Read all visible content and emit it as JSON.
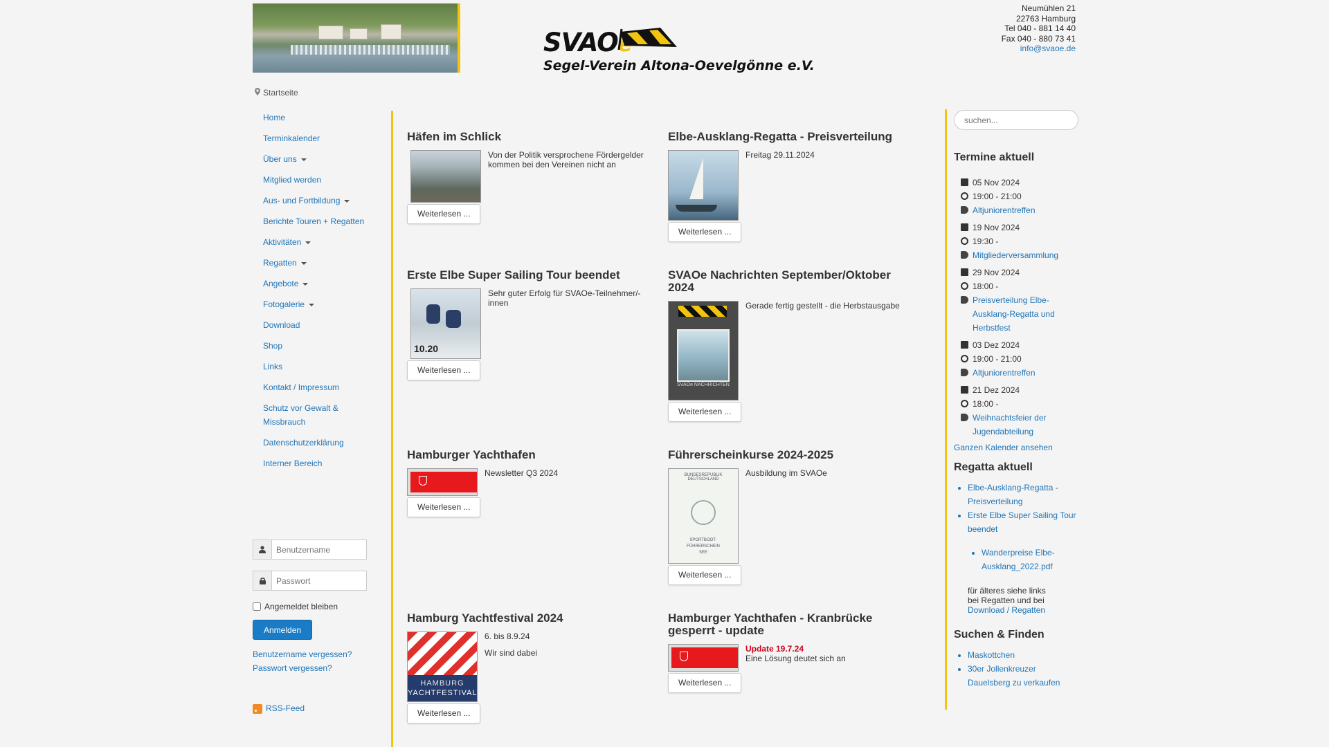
{
  "header": {
    "logo_text": "SVAO",
    "logo_e": "e",
    "logo_subtitle": "Segel-Verein Altona-Oevelgönne e.V.",
    "address_lines": [
      "Neumühlen 21",
      "22763 Hamburg",
      "Tel 040 - 881 14 40",
      "Fax 040 - 880 73 41"
    ],
    "email": "info@svaoe.de"
  },
  "breadcrumb": "Startseite",
  "nav": {
    "items": [
      {
        "label": "Home"
      },
      {
        "label": "Terminkalender"
      },
      {
        "label": "Über uns"
      },
      {
        "label": "Mitglied werden"
      },
      {
        "label": "Aus- und Fortbildung"
      },
      {
        "label": "Berichte Touren + Regatten"
      },
      {
        "label": "Aktivitäten"
      },
      {
        "label": "Regatten"
      },
      {
        "label": "Angebote"
      },
      {
        "label": "Fotogalerie"
      },
      {
        "label": "Download"
      },
      {
        "label": "Shop"
      },
      {
        "label": "Links"
      },
      {
        "label": "Kontakt / Impressum"
      },
      {
        "label": "Schutz vor Gewalt & Missbrauch"
      },
      {
        "label": "Datenschutzerklärung"
      },
      {
        "label": "Interner Bereich"
      }
    ]
  },
  "login": {
    "username_placeholder": "Benutzername",
    "password_placeholder": "Passwort",
    "remember_label": "Angemeldet bleiben",
    "submit_label": "Anmelden",
    "forgot_username": "Benutzername vergessen?",
    "forgot_password": "Passwort vergessen?",
    "rss_label": "RSS-Feed"
  },
  "articles": {
    "more_label": "Weiterlesen ...",
    "a1": {
      "title": "Häfen im Schlick",
      "intro": "Von der Politik versprochene Fördergelder kommen bei den Vereinen nicht an"
    },
    "a2": {
      "title": "Elbe-Ausklang-Regatta - Preisverteilung",
      "intro": "Freitag 29.11.2024"
    },
    "a3": {
      "title": "Erste Elbe Super Sailing Tour beendet",
      "intro": "Sehr guter Erfolg für SVAOe-Teilnehmer/-innen",
      "thumb_text": "10.20"
    },
    "a4": {
      "title": "SVAOe Nachrichten September/Oktober 2024",
      "intro": "Gerade fertig gestellt - die Herbstausgabe",
      "thumb_text": "SVAOe NACHRICHTEN"
    },
    "a5": {
      "title": "Hamburger Yachthafen",
      "intro": "Newsletter Q3 2024"
    },
    "a6": {
      "title": "Führerscheinkurse 2024-2025",
      "intro": "Ausbildung im SVAOe",
      "thumb_top": "BUNDESREPUBLIK DEUTSCHLAND",
      "thumb_line1": "SPORTBOOT-",
      "thumb_line2": "FÜHRERSCHEIN",
      "thumb_line3": "SEE"
    },
    "a7": {
      "title": "Hamburg Yachtfestival 2024",
      "intro": "6. bis 8.9.24",
      "intro2": "Wir sind dabei",
      "thumb_line1": "HAMBURG",
      "thumb_line2": "YACHTFESTIVAL"
    },
    "a8": {
      "title": "Hamburger Yachthafen - Kranbrücke gesperrt - update",
      "update": "Update 19.7.24",
      "intro": "Eine Lösung deutet sich an"
    }
  },
  "sidebar": {
    "search_placeholder": "suchen...",
    "termine_heading": "Termine aktuell",
    "events": [
      {
        "date": "05 Nov 2024",
        "time": "19:00 - 21:00",
        "title": "Altjuniorentreffen"
      },
      {
        "date": "19 Nov 2024",
        "time": "19:30 -",
        "title": "Mitgliederversammlung"
      },
      {
        "date": "29 Nov 2024",
        "time": "18:00 -",
        "title": "Preisverteilung Elbe-Ausklang-Regatta und Herbstfest"
      },
      {
        "date": "03 Dez 2024",
        "time": "19:00 - 21:00",
        "title": "Altjuniorentreffen"
      },
      {
        "date": "21 Dez 2024",
        "time": "18:00 -",
        "title": "Weihnachtsfeier der Jugendabteilung"
      }
    ],
    "full_calendar": "Ganzen Kalender ansehen",
    "regatta_heading": "Regatta aktuell",
    "regatta_links": [
      "Elbe-Ausklang-Regatta - Preisverteilung",
      "Erste Elbe Super Sailing Tour beendet"
    ],
    "regatta_sub_link": "Wanderpreise Elbe-Ausklang_2022.pdf",
    "older_line1": "für älteres siehe links",
    "older_line2": "bei Regatten und bei",
    "older_link": "Download / Regatten",
    "find_heading": "Suchen & Finden",
    "find_links": [
      "Maskottchen",
      "30er Jollenkreuzer Dauelsberg zu verkaufen"
    ]
  }
}
